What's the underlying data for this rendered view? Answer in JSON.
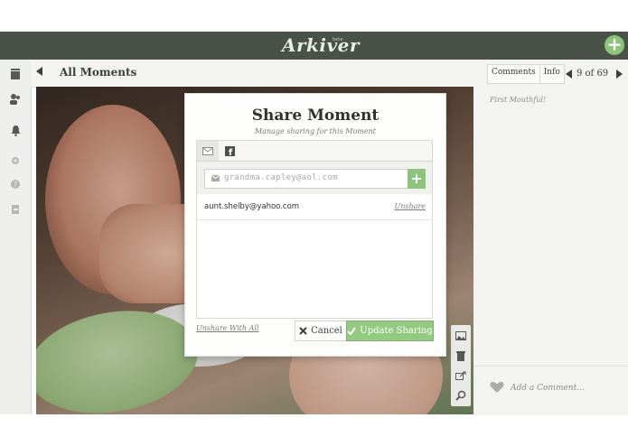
{
  "app": {
    "logo_text": "Arkiver",
    "beta_tag": "beta"
  },
  "topbar": {
    "add_button_icon": "plus-circle-icon",
    "accent": "#8dc37a",
    "bar_color": "#4a5148"
  },
  "sidebar": {
    "icons": [
      "book-icon",
      "people-icon",
      "bell-icon",
      "gear-icon",
      "help-icon",
      "logout-icon"
    ]
  },
  "header": {
    "title": "All Moments"
  },
  "photo": {
    "description_icon": "photo"
  },
  "tools": {
    "icons": [
      "image-icon",
      "trash-icon",
      "share-icon",
      "zoom-icon"
    ]
  },
  "right_panel": {
    "tabs": [
      {
        "label": "Comments"
      },
      {
        "label": "Info"
      }
    ],
    "position_text": "9 of 69",
    "caption": "First Mouthful!",
    "comment_placeholder": "Add a Comment..."
  },
  "modal": {
    "title": "Share Moment",
    "subtitle": "Manage sharing for this Moment",
    "tabs": [
      {
        "icon": "email-icon",
        "active": true
      },
      {
        "icon": "facebook-icon",
        "active": false
      }
    ],
    "email_input": {
      "placeholder": "grandma.capley@aol.com"
    },
    "shared_with": [
      {
        "email": "aunt.shelby@yahoo.com",
        "action": "Unshare"
      }
    ],
    "unshare_all": "Unshare With All",
    "cancel_label": "Cancel",
    "update_label": "Update Sharing"
  }
}
